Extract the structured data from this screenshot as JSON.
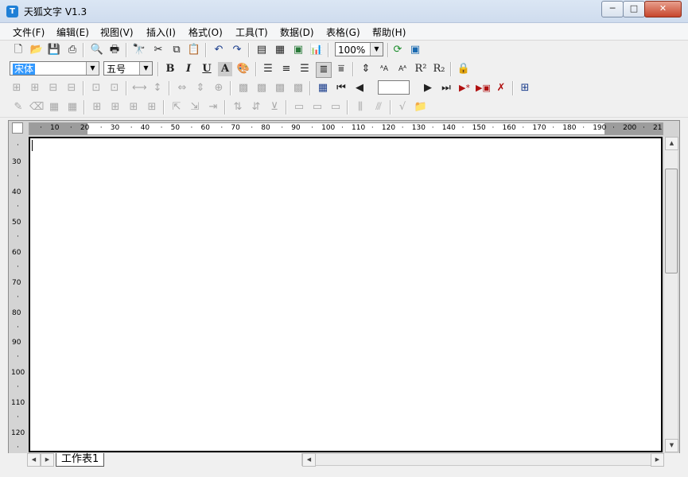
{
  "window": {
    "title": "天狐文字 V1.3",
    "icon_text": "T",
    "minimize": "─",
    "maximize": "□",
    "close": "✕"
  },
  "menu": [
    "文件(F)",
    "编辑(E)",
    "视图(V)",
    "插入(I)",
    "格式(O)",
    "工具(T)",
    "数据(D)",
    "表格(G)",
    "帮助(H)"
  ],
  "toolbar1": {
    "zoom": "100%"
  },
  "toolbar2": {
    "font": "宋体",
    "size": "五号",
    "bold": "B",
    "italic": "I",
    "underline": "U",
    "shadow": "A",
    "superscript": "R²",
    "subscript": "R₂"
  },
  "ruler": {
    "h_labels": [
      "10",
      "20",
      "30",
      "40",
      "50",
      "60",
      "70",
      "80",
      "90",
      "100",
      "110",
      "120",
      "130",
      "140",
      "150",
      "160",
      "170",
      "180",
      "190",
      "200",
      "21"
    ],
    "v_labels": [
      "30",
      "40",
      "50",
      "60",
      "70",
      "80",
      "90",
      "100",
      "110",
      "120"
    ]
  },
  "sheet_tab": "工作表1",
  "icons": [
    "new-doc-icon",
    "open-folder-icon",
    "save-icon",
    "print-setup-icon",
    "print-preview-icon",
    "print-icon",
    "find-icon",
    "cut-icon",
    "copy-icon",
    "paste-icon",
    "undo-icon",
    "redo-icon",
    "text-box-icon",
    "table-icon",
    "image-icon",
    "chart-icon",
    "refresh-icon",
    "view-icon",
    "lock-icon"
  ]
}
